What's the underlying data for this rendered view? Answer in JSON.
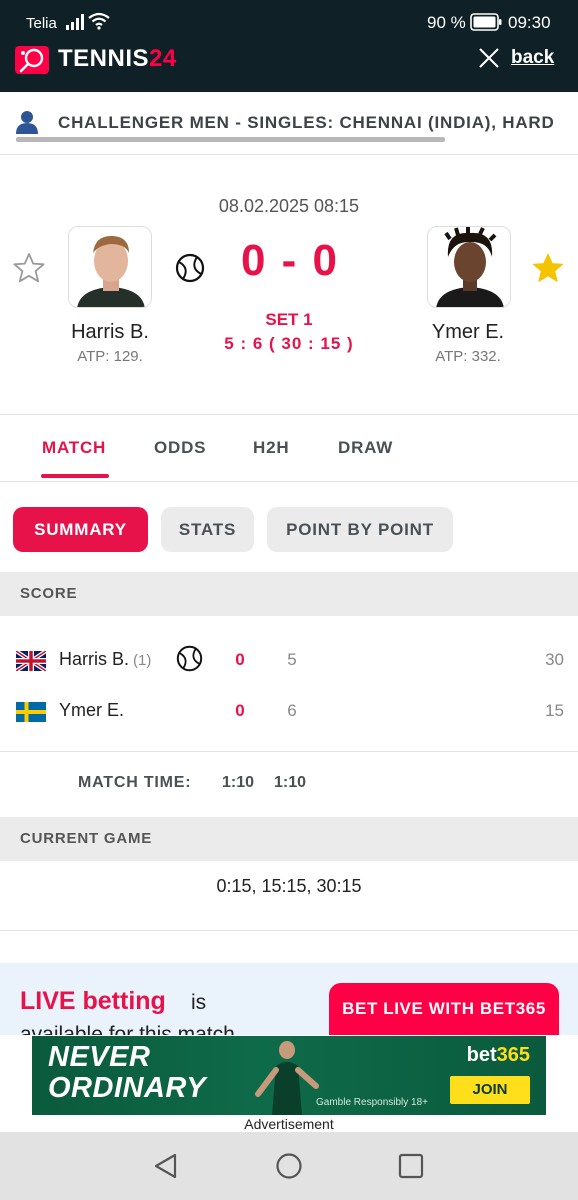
{
  "status_bar": {
    "carrier": "Telia",
    "battery_percent": "90 %",
    "time": "09:30"
  },
  "header": {
    "logo_text_main": "TENNIS",
    "logo_text_num": "24",
    "back_label": "back"
  },
  "tournament": {
    "name": "CHALLENGER MEN - SINGLES: CHENNAI (INDIA), HARD"
  },
  "match": {
    "datetime": "08.02.2025 08:15",
    "score": "0 - 0",
    "set_label": "SET 1",
    "game_score": "5 : 6 ( 30 : 15 )",
    "home": {
      "name": "Harris B.",
      "rank": "ATP: 129.",
      "favorite": false
    },
    "away": {
      "name": "Ymer E.",
      "rank": "ATP: 332.",
      "favorite": true
    }
  },
  "main_tabs": [
    "MATCH",
    "ODDS",
    "H2H",
    "DRAW"
  ],
  "sub_tabs": [
    "SUMMARY",
    "STATS",
    "POINT BY POINT"
  ],
  "score_section": {
    "title": "SCORE",
    "rows": [
      {
        "name": "Harris B.",
        "seed": "(1)",
        "sets": "0",
        "games": "5",
        "points": "30",
        "serving": true
      },
      {
        "name": "Ymer E.",
        "seed": "",
        "sets": "0",
        "games": "6",
        "points": "15",
        "serving": false
      }
    ],
    "match_time_label": "MATCH TIME:",
    "match_time_total": "1:10",
    "match_time_set1": "1:10"
  },
  "current_game": {
    "title": "CURRENT GAME",
    "progression": "0:15, 15:15, 30:15"
  },
  "promo": {
    "live_label": "LIVE betting",
    "text": "is",
    "text_line2": "available for this match",
    "button_label": "BET LIVE WITH BET365"
  },
  "advertisement": {
    "headline_line1": "NEVER",
    "headline_line2": "ORDINARY",
    "brand_main": "bet",
    "brand_num": "365",
    "join_label": "JOIN",
    "disclaimer": "Gamble Responsibly  18+",
    "label": "Advertisement"
  },
  "colors": {
    "accent": "#e8124a",
    "header_bg": "#0f2126",
    "star_active": "#f5c400"
  }
}
